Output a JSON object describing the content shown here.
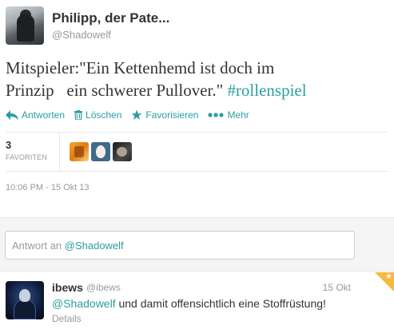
{
  "tweet": {
    "fullname": "Philipp, der Pate...",
    "screen_name": "@Shadowelf",
    "text_main": "Mitspieler:\"Ein Kettenhemd ist doch im\nPrinzip   ein schwerer Pullover.\" ",
    "hashtag": "#rollenspiel",
    "timestamp": "10:06 PM - 15 Okt 13"
  },
  "actions": {
    "reply": "Antworten",
    "delete": "Löschen",
    "favorite": "Favorisieren",
    "more": "Mehr"
  },
  "stats": {
    "favorites_count": "3",
    "favorites_label": "FAVORITEN"
  },
  "reply_box": {
    "prefix": "Antwort an ",
    "mention": "@Shadowelf"
  },
  "reply_tweet": {
    "name": "ibews",
    "handle": "@ibews",
    "date": "15 Okt",
    "mention": "@Shadowelf",
    "text": " und damit offensichtlich eine Stoffrüstung!",
    "details": "Details"
  },
  "colors": {
    "accent": "#2a9ea0",
    "favorite_corner": "#f6b93b"
  },
  "icons": [
    "reply-arrow-icon",
    "trash-icon",
    "star-icon",
    "more-dots-icon"
  ]
}
